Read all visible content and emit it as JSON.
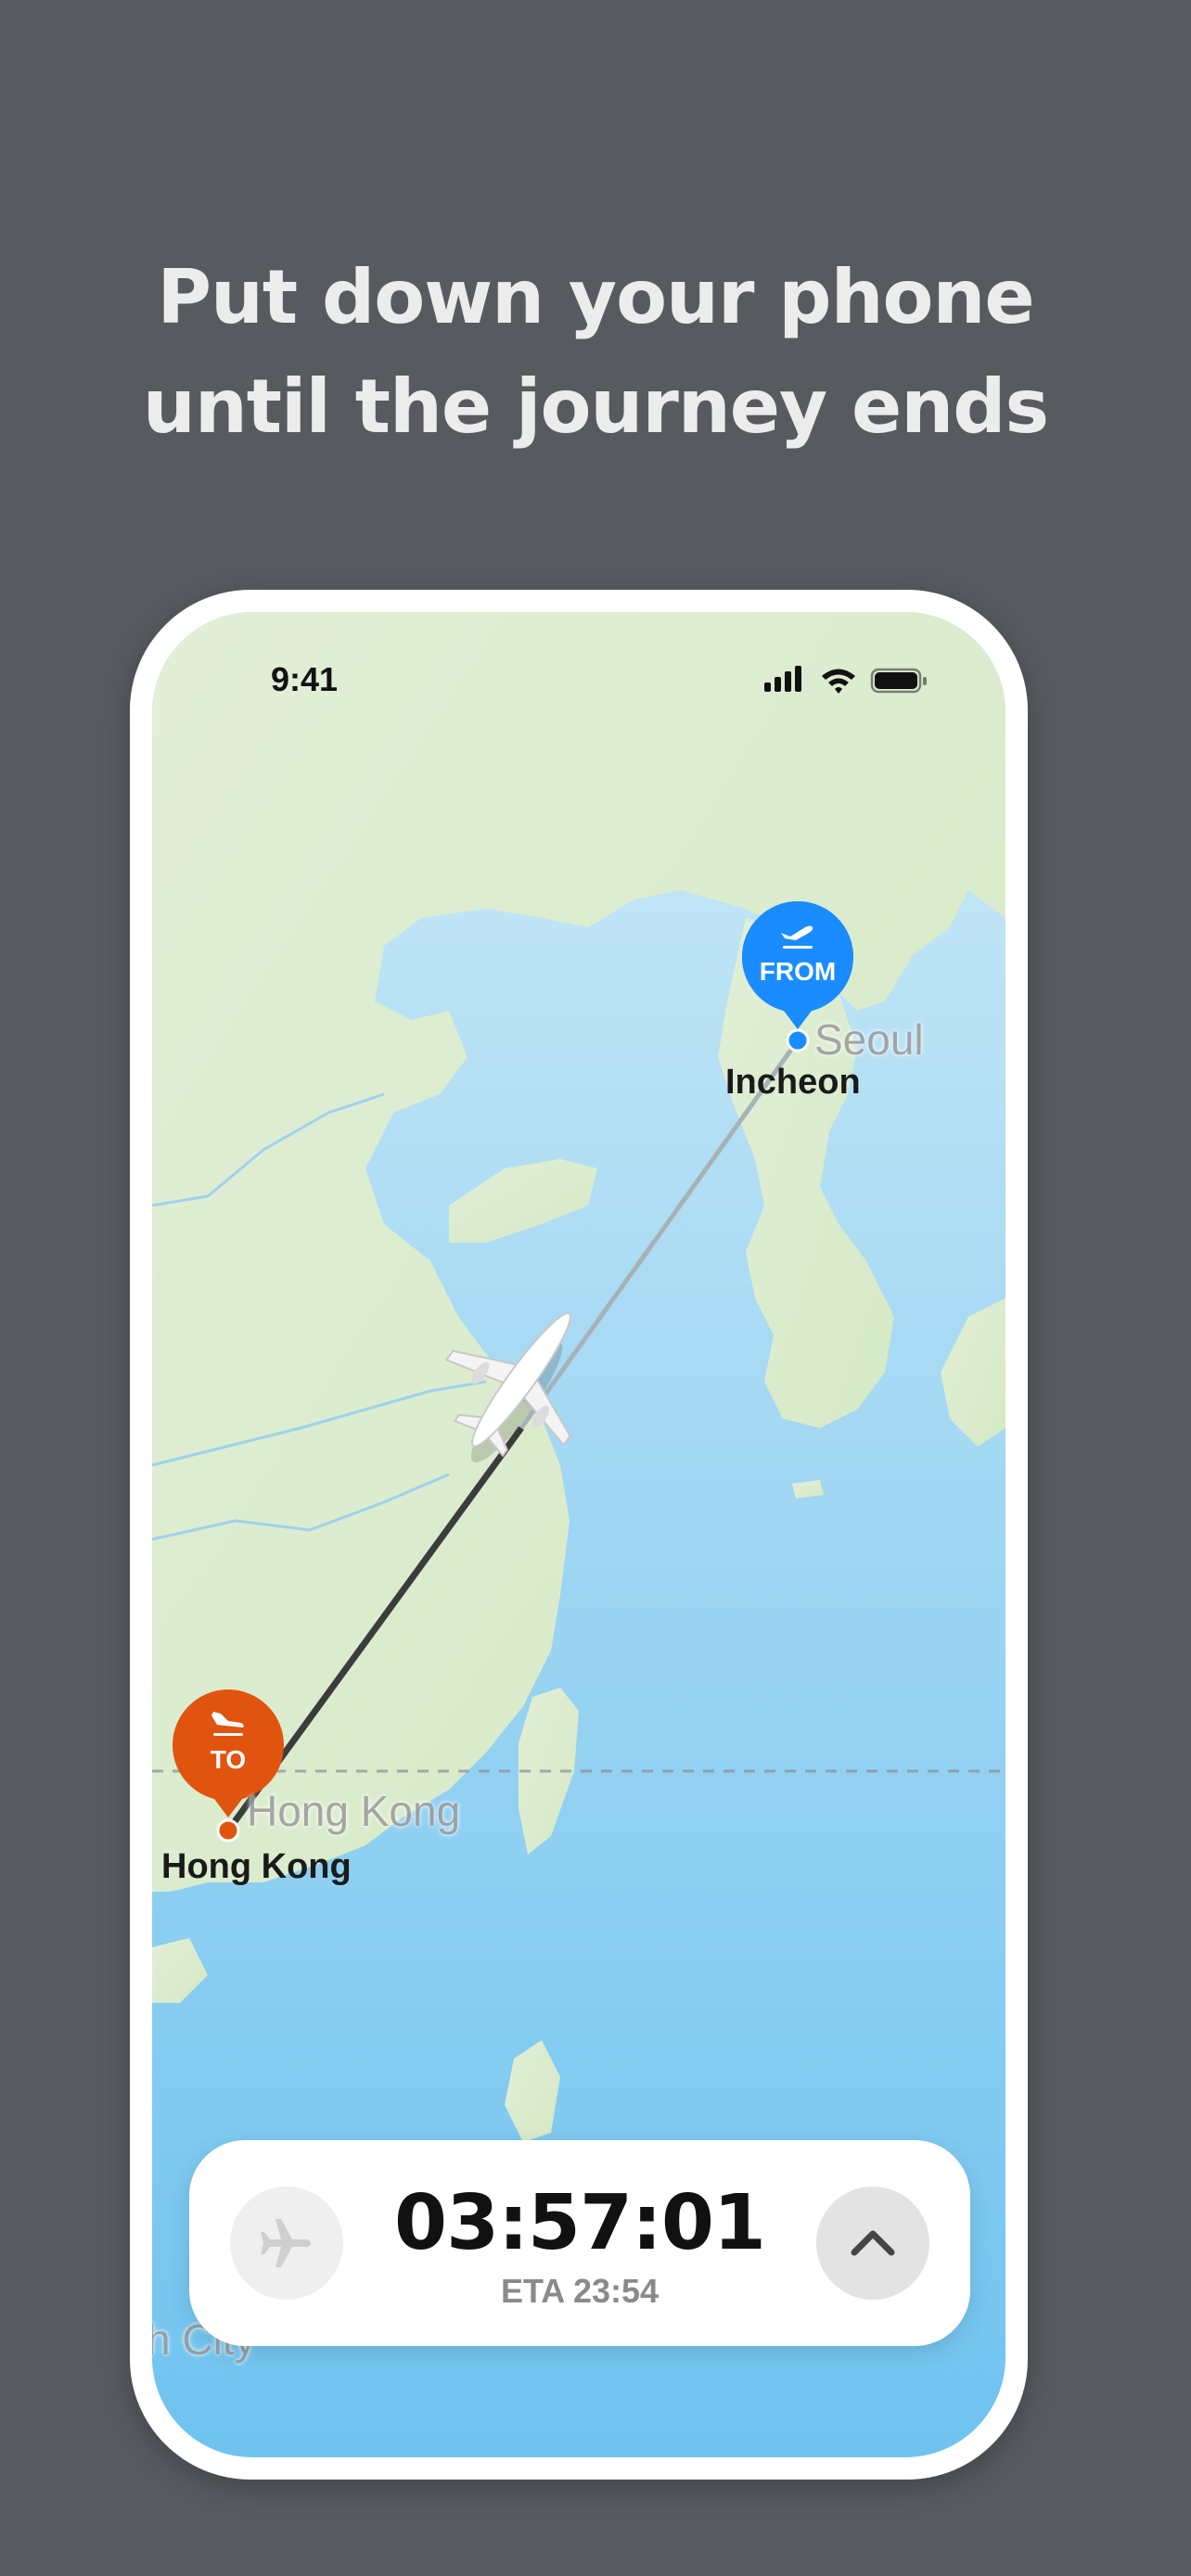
{
  "headline": {
    "line1": "Put down your phone",
    "line2": "until the journey ends"
  },
  "status_bar": {
    "time": "9:41",
    "icons": [
      "cellular-signal-icon",
      "wifi-icon",
      "battery-icon"
    ]
  },
  "map": {
    "origin": {
      "badge": "FROM",
      "badge_icon": "takeoff-icon",
      "airport": "Incheon",
      "map_city": "Seoul",
      "color": "#1a8cff"
    },
    "destination": {
      "badge": "TO",
      "badge_icon": "landing-icon",
      "airport": "Hong Kong",
      "map_city": "Hong Kong",
      "color": "#e05410"
    },
    "partial_city_label": "h City"
  },
  "flight_card": {
    "countdown": "03:57:01",
    "eta": "ETA 23:54",
    "left_button_icon": "airplane-icon",
    "right_button_icon": "chevron-up-icon"
  }
}
